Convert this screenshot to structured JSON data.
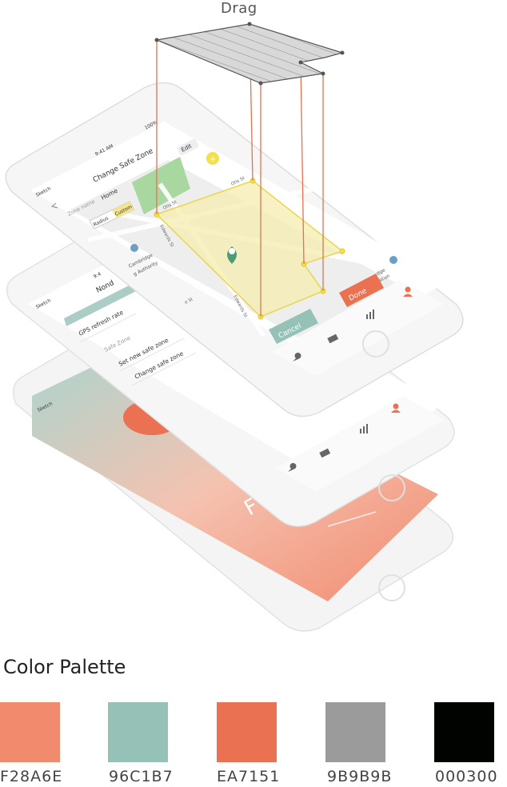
{
  "top_label": "Drag",
  "phone_top": {
    "status_carrier": "Sketch",
    "status_time": "9:41 AM",
    "status_battery": "100%",
    "title": "Change Safe Zone",
    "edit_button": "Edit",
    "zone_name_label": "Zone name",
    "zone_name_value": "Home",
    "mode_radius": "Radius",
    "mode_custom": "Custom",
    "street_1": "Otis St",
    "street_2": "Otis St",
    "street_3": "Edwards St",
    "street_4": "Edwards St",
    "street_5": "e St",
    "map_place_1a": "Cambridge",
    "map_place_1b": "g Authority",
    "map_place_2a": "dge",
    "map_place_2b": "ascun",
    "cancel_button": "Cancel",
    "done_button": "Done"
  },
  "phone_middle": {
    "status_carrier": "Sketch",
    "status_time": "9:4",
    "title": "Nond",
    "row_gps": "GPS refresh rate",
    "section_label": "Safe Zone",
    "row_set_new": "Set new safe zone",
    "row_change": "Change safe zone"
  },
  "phone_bottom": {
    "status_carrier": "Sketch",
    "hero_text": "F"
  },
  "palette": {
    "title": "Color Palette",
    "colors": [
      {
        "hex": "#F28A6E",
        "label": "F28A6E"
      },
      {
        "hex": "#96C1B7",
        "label": "96C1B7"
      },
      {
        "hex": "#EA7151",
        "label": "EA7151"
      },
      {
        "hex": "#9B9B9B",
        "label": "9B9B9B"
      },
      {
        "hex": "#000300",
        "label": "000300"
      }
    ]
  }
}
